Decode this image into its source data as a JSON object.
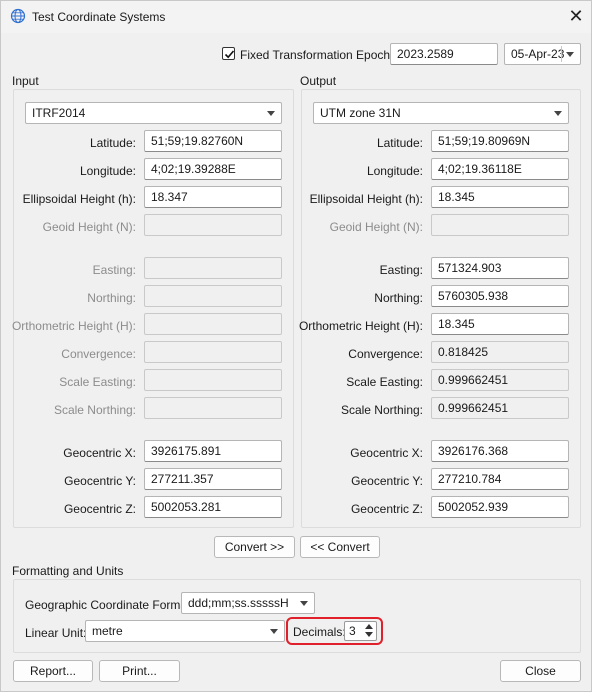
{
  "window": {
    "title": "Test Coordinate Systems",
    "close_glyph": "✕",
    "icon": "globe-icon"
  },
  "epoch": {
    "checkbox_label": "Fixed Transformation Epoch:",
    "checked": true,
    "value": "2023.2589",
    "date": "05-Apr-23"
  },
  "input": {
    "group_title": "Input",
    "system": "ITRF2014",
    "fields": [
      {
        "label": "Latitude:",
        "value": "51;59;19.82760N",
        "enabled": true
      },
      {
        "label": "Longitude:",
        "value": "4;02;19.39288E",
        "enabled": true
      },
      {
        "label": "Ellipsoidal Height (h):",
        "value": "18.347",
        "enabled": true
      },
      {
        "label": "Geoid Height (N):",
        "value": "",
        "enabled": false
      },
      {
        "label": "Easting:",
        "value": "",
        "enabled": false
      },
      {
        "label": "Northing:",
        "value": "",
        "enabled": false
      },
      {
        "label": "Orthometric Height (H):",
        "value": "",
        "enabled": false
      },
      {
        "label": "Convergence:",
        "value": "",
        "enabled": false
      },
      {
        "label": "Scale Easting:",
        "value": "",
        "enabled": false
      },
      {
        "label": "Scale Northing:",
        "value": "",
        "enabled": false
      },
      {
        "label": "Geocentric X:",
        "value": "3926175.891",
        "enabled": true
      },
      {
        "label": "Geocentric Y:",
        "value": "277211.357",
        "enabled": true
      },
      {
        "label": "Geocentric Z:",
        "value": "5002053.281",
        "enabled": true
      }
    ]
  },
  "output": {
    "group_title": "Output",
    "system": "UTM zone 31N",
    "fields": [
      {
        "label": "Latitude:",
        "value": "51;59;19.80969N",
        "enabled": true
      },
      {
        "label": "Longitude:",
        "value": "4;02;19.36118E",
        "enabled": true
      },
      {
        "label": "Ellipsoidal Height (h):",
        "value": "18.345",
        "enabled": true
      },
      {
        "label": "Geoid Height (N):",
        "value": "",
        "enabled": false
      },
      {
        "label": "Easting:",
        "value": "571324.903",
        "enabled": true
      },
      {
        "label": "Northing:",
        "value": "5760305.938",
        "enabled": true
      },
      {
        "label": "Orthometric Height (H):",
        "value": "18.345",
        "enabled": true
      },
      {
        "label": "Convergence:",
        "value": "0.818425",
        "enabled": true,
        "readonly": true
      },
      {
        "label": "Scale Easting:",
        "value": "0.999662451",
        "enabled": true,
        "readonly": true
      },
      {
        "label": "Scale Northing:",
        "value": "0.999662451",
        "enabled": true,
        "readonly": true
      },
      {
        "label": "Geocentric X:",
        "value": "3926176.368",
        "enabled": true
      },
      {
        "label": "Geocentric Y:",
        "value": "277210.784",
        "enabled": true
      },
      {
        "label": "Geocentric Z:",
        "value": "5002052.939",
        "enabled": true
      }
    ]
  },
  "convert": {
    "forward_label": "Convert >>",
    "backward_label": "<< Convert"
  },
  "formatting": {
    "group_title": "Formatting and Units",
    "geo_format_label": "Geographic Coordinate Format:",
    "geo_format_value": "ddd;mm;ss.sssssH",
    "linear_unit_label": "Linear Unit:",
    "linear_unit_value": "metre",
    "decimals_label": "Decimals:",
    "decimals_value": "3",
    "highlight_color": "#e0202a"
  },
  "footer": {
    "report_label": "Report...",
    "print_label": "Print...",
    "close_label": "Close"
  }
}
